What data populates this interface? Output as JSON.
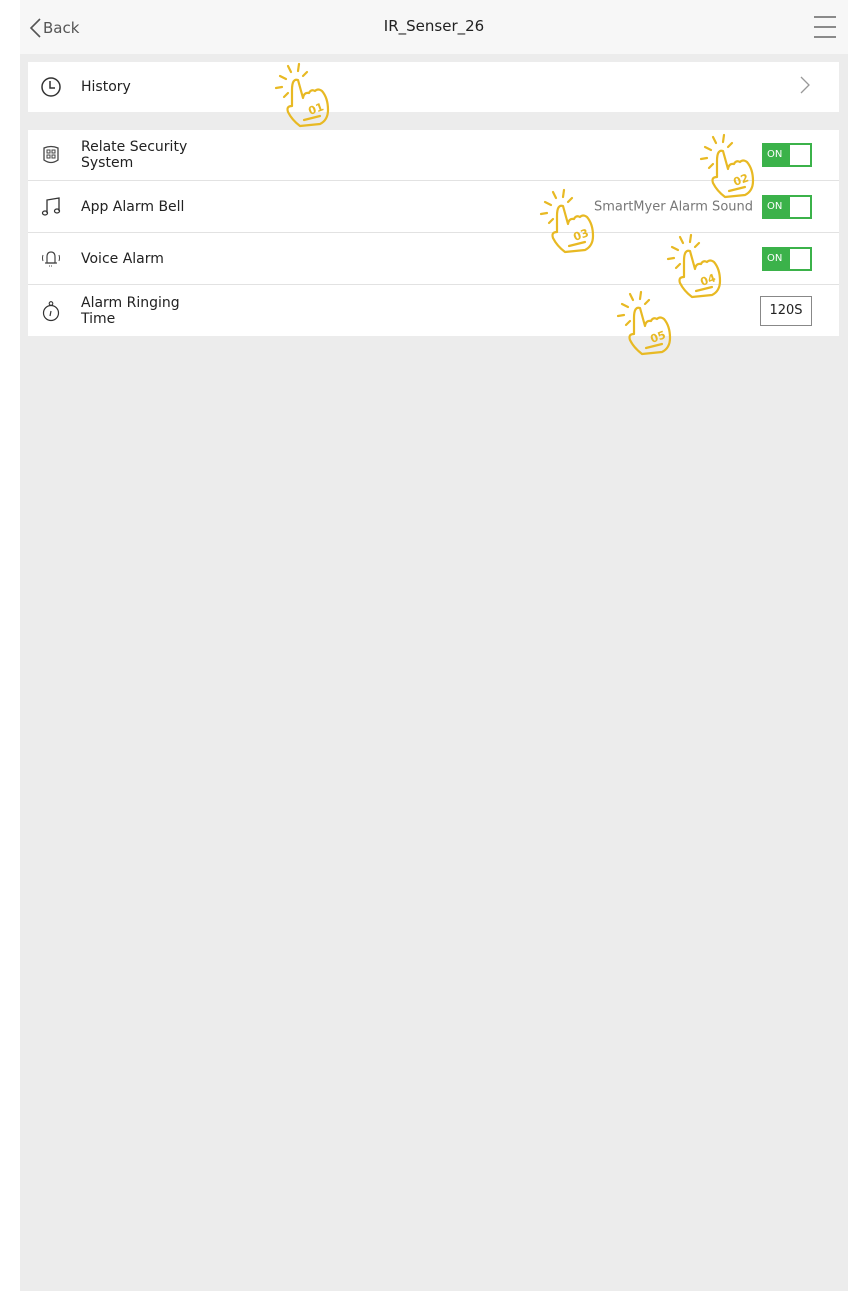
{
  "header": {
    "back_label": "Back",
    "title": "IR_Senser_26",
    "menu_icon": "hamburger-menu-icon"
  },
  "history": {
    "label": "History",
    "icon": "clock-icon",
    "trailing_icon": "chevron-right-icon"
  },
  "settings": [
    {
      "label_line1": "Relate Security",
      "label_line2": "System",
      "icon": "security-panel-icon",
      "toggle_text": "ON"
    },
    {
      "label": "App Alarm Bell",
      "icon": "music-note-icon",
      "value": "SmartMyer Alarm Sound",
      "toggle_text": "ON"
    },
    {
      "label": "Voice Alarm",
      "icon": "bell-ringing-icon",
      "toggle_text": "ON"
    },
    {
      "label_line1": "Alarm Ringing",
      "label_line2": "Time",
      "icon": "stopwatch-icon",
      "value": "120S"
    }
  ],
  "annotations": [
    "01",
    "02",
    "03",
    "04",
    "05"
  ],
  "colors": {
    "toggle_on": "#3bb24a",
    "annotation": "#e8b923",
    "background": "#ececec"
  }
}
